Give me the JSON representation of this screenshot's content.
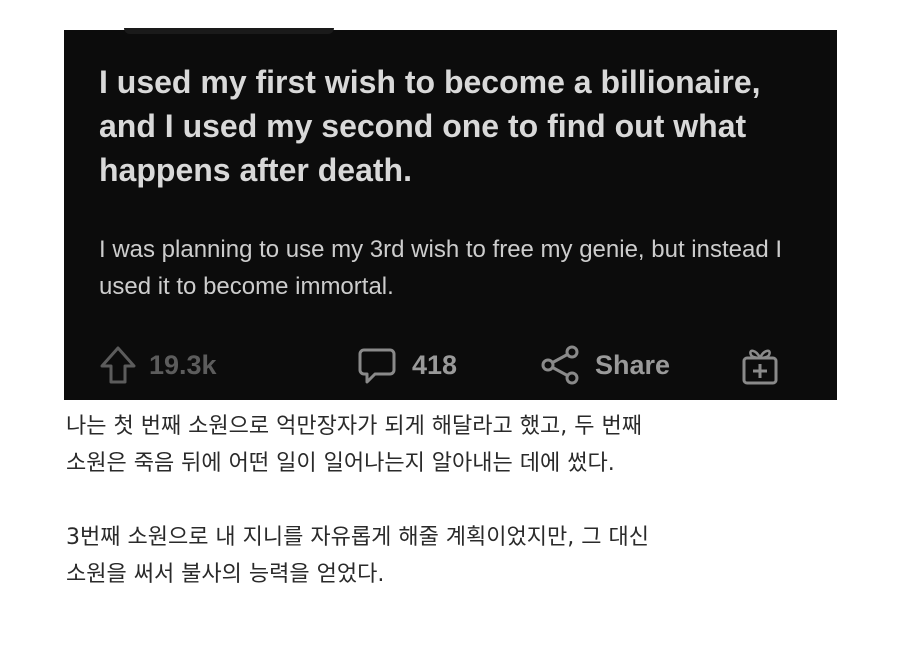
{
  "post": {
    "title": "I used my first wish to become a billionaire, and I used my second one to find out what happens after death.",
    "body": "I was planning to use my 3rd wish to free my genie, but instead I used it to become immortal.",
    "actions": {
      "upvote_icon": "arrow-up-icon",
      "upvotes": "19.3k",
      "comment_icon": "comment-bubble-icon",
      "comments": "418",
      "share_icon": "share-icon",
      "share_label": "Share",
      "award_icon": "gift-award-icon"
    },
    "colors": {
      "card_background": "#0c0c0c",
      "title_text": "#d9d9d9",
      "action_text": "#8a8a8a"
    }
  },
  "translation": {
    "paragraph1": "나는 첫 번째 소원으로 억만장자가 되게 해달라고 했고, 두 번째\n소원은 죽음 뒤에 어떤 일이 일어나는지 알아내는 데에 썼다.",
    "paragraph2": "3번째 소원으로 내 지니를 자유롭게 해줄 계획이었지만, 그 대신\n소원을 써서 불사의 능력을 얻었다."
  }
}
